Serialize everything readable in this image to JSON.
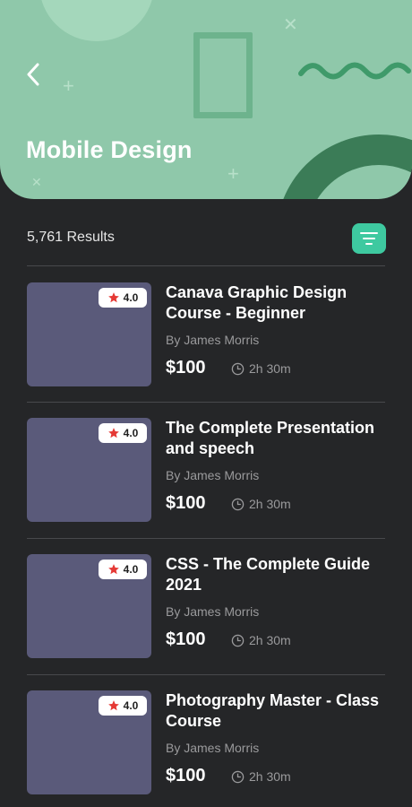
{
  "header": {
    "title": "Mobile Design",
    "background_color": "#8fc8aa",
    "back_icon": "chevron-left-icon"
  },
  "results": {
    "count_label": "5,761 Results",
    "filter_icon": "filter-icon",
    "filter_color": "#3ec9a0"
  },
  "courses": [
    {
      "title": "Canava Graphic Design Course - Beginner",
      "author": "By James Morris",
      "price": "$100",
      "duration": "2h 30m",
      "rating": "4.0"
    },
    {
      "title": "The Complete Presentation and speech",
      "author": "By James Morris",
      "price": "$100",
      "duration": "2h 30m",
      "rating": "4.0"
    },
    {
      "title": "CSS - The Complete Guide 2021",
      "author": "By James Morris",
      "price": "$100",
      "duration": "2h 30m",
      "rating": "4.0"
    },
    {
      "title": "Photography Master - Class Course",
      "author": "By James Morris",
      "price": "$100",
      "duration": "2h 30m",
      "rating": "4.0"
    }
  ],
  "colors": {
    "background": "#252628",
    "thumbnail": "#5a5a7a",
    "star": "#e53935"
  }
}
